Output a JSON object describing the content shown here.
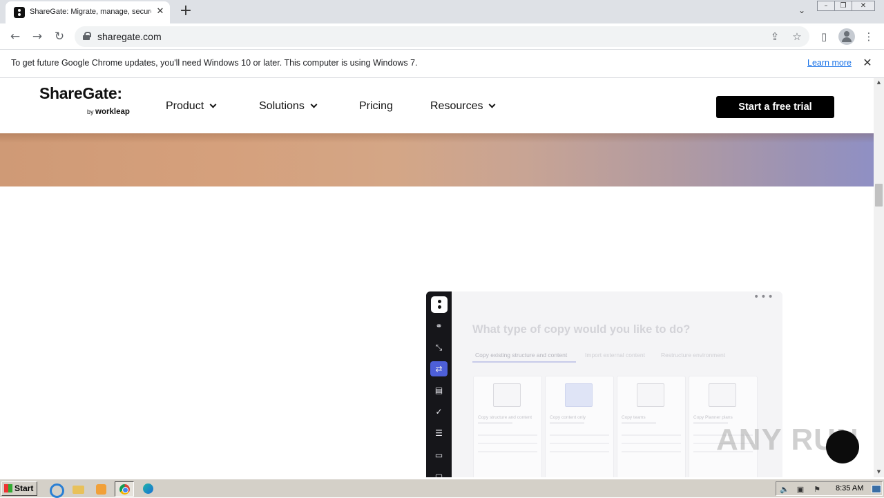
{
  "browser": {
    "tab_title": "ShareGate: Migrate, manage, secure",
    "tab_close": "✕",
    "new_tab": "+",
    "url": "sharegate.com",
    "window_controls": [
      "minimize",
      "restore",
      "close"
    ]
  },
  "infobar": {
    "message": "To get future Google Chrome updates, you'll need Windows 10 or later. This computer is using Windows 7.",
    "link": "Learn more",
    "close": "✕"
  },
  "site": {
    "logo_word": "ShareGate:",
    "logo_by": "by",
    "logo_brand": "workleap",
    "nav": [
      "Product",
      "Solutions",
      "Pricing",
      "Resources"
    ],
    "cta": "Start a free trial",
    "hero_colors": [
      "#cf9a76",
      "#8f90c4"
    ]
  },
  "app_mock": {
    "menu_dots": "•••",
    "question": "What type of copy would you like to do?",
    "tabs": [
      "Copy existing structure and content",
      "Import external content",
      "Restructure environment"
    ],
    "cards": [
      {
        "title": "Copy structure and content"
      },
      {
        "title": "Copy content only"
      },
      {
        "title": "Copy teams"
      },
      {
        "title": "Copy Planner plans"
      }
    ],
    "rail_icons": [
      "binoculars-icon",
      "expand-icon",
      "copy-icon",
      "clipboard-icon",
      "shield-check-icon",
      "list-check-icon",
      "calendar-icon",
      "document-icon"
    ],
    "active_color": "#4d5fd8"
  },
  "watermark": {
    "text": "ANY RUN"
  },
  "taskbar": {
    "start": "Start",
    "time": "8:35 AM"
  }
}
